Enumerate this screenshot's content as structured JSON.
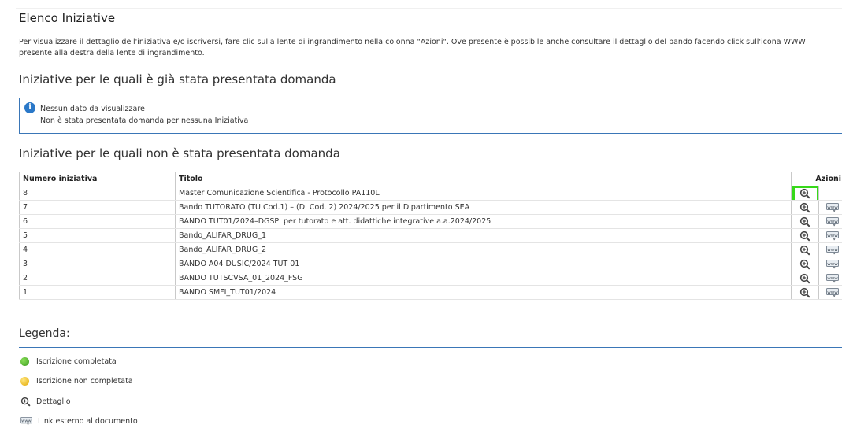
{
  "page": {
    "title": "Elenco Iniziative",
    "intro_line1": "Per visualizzare il dettaglio dell'iniziativa e/o iscriversi, fare clic sulla lente di ingrandimento nella colonna \"Azioni\". Ove presente è possibile anche consultare il dettaglio del bando facendo click sull'icona WWW",
    "intro_line2": "presente alla destra della lente di ingrandimento."
  },
  "section_presented": {
    "heading": "Iniziative per le quali è già stata presentata domanda",
    "info_title": "Nessun dato da visualizzare",
    "info_text": "Non è stata presentata domanda per nessuna Iniziativa"
  },
  "section_not_presented": {
    "heading": "Iniziative per le quali non è stata presentata domanda",
    "columns": {
      "numero": "Numero iniziativa",
      "titolo": "Titolo",
      "azioni": "Azioni"
    },
    "rows": [
      {
        "numero": "8",
        "titolo": "Master Comunicazione Scientifica - Protocollo PA110L",
        "has_www": false,
        "highlighted": true
      },
      {
        "numero": "7",
        "titolo": "Bando TUTORATO (TU Cod.1) – (DI Cod. 2) 2024/2025 per il Dipartimento SEA",
        "has_www": true,
        "highlighted": false
      },
      {
        "numero": "6",
        "titolo": "BANDO TUT01/2024–DGSPI per tutorato e att. didattiche integrative a.a.2024/2025",
        "has_www": true,
        "highlighted": false
      },
      {
        "numero": "5",
        "titolo": "Bando_ALIFAR_DRUG_1",
        "has_www": true,
        "highlighted": false
      },
      {
        "numero": "4",
        "titolo": "Bando_ALIFAR_DRUG_2",
        "has_www": true,
        "highlighted": false
      },
      {
        "numero": "3",
        "titolo": "BANDO A04 DUSIC/2024 TUT 01",
        "has_www": true,
        "highlighted": false
      },
      {
        "numero": "2",
        "titolo": "BANDO TUTSCVSA_01_2024_FSG",
        "has_www": true,
        "highlighted": false
      },
      {
        "numero": "1",
        "titolo": "BANDO SMFI_TUT01/2024",
        "has_www": true,
        "highlighted": false
      }
    ]
  },
  "legend": {
    "title": "Legenda:",
    "items": [
      {
        "icon": "green-dot-icon",
        "label": "Iscrizione completata"
      },
      {
        "icon": "yellow-dot-icon",
        "label": "Iscrizione non completata"
      },
      {
        "icon": "magnifier-icon",
        "label": "Dettaglio"
      },
      {
        "icon": "www-icon",
        "label": "Link esterno al documento"
      }
    ]
  },
  "colors": {
    "accent_blue": "#3a76b7",
    "highlight_green": "#37d91a",
    "status_green": "#4caf2a",
    "status_yellow": "#f2c200"
  }
}
